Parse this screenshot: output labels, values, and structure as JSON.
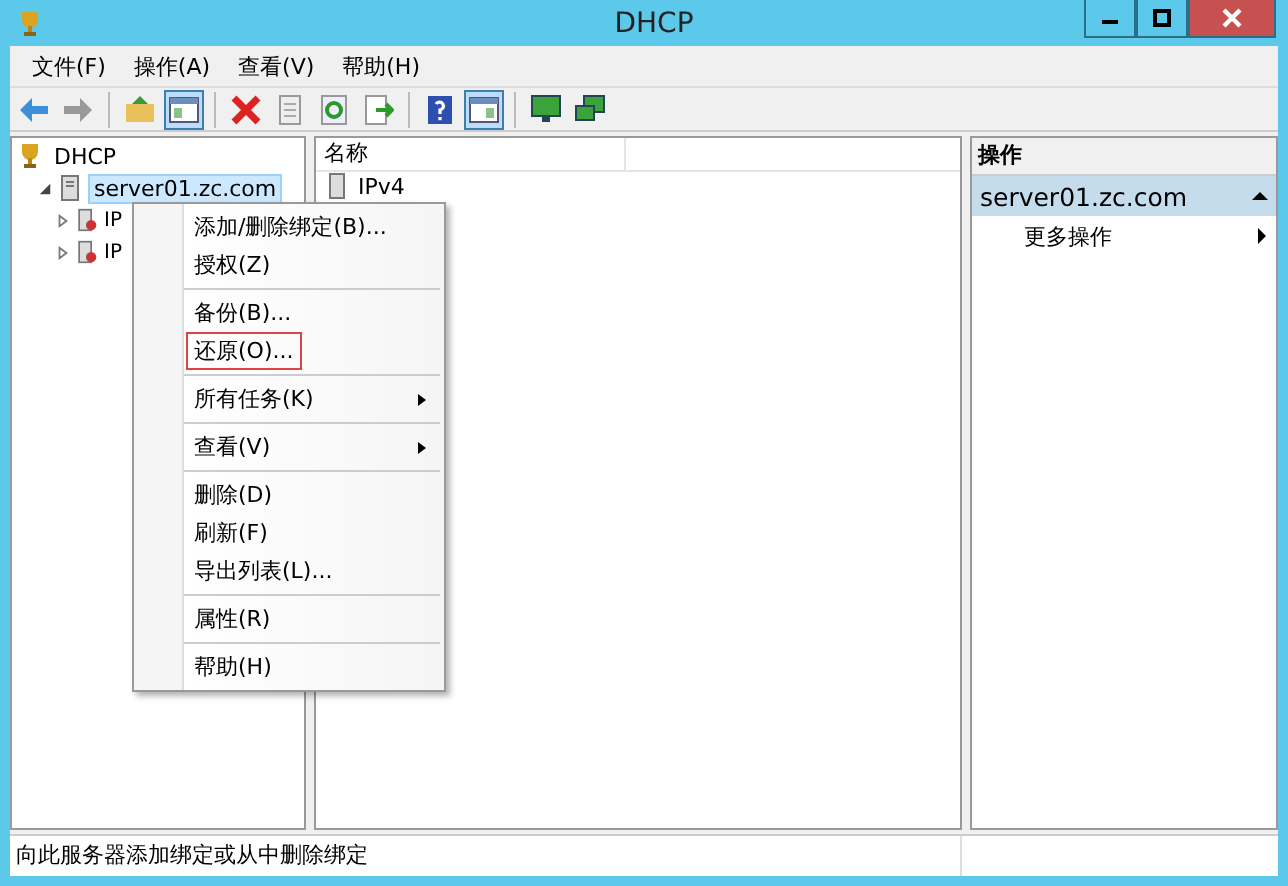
{
  "window": {
    "title": "DHCP"
  },
  "menu_bar": [
    "文件(F)",
    "操作(A)",
    "查看(V)",
    "帮助(H)"
  ],
  "toolbar": [
    {
      "kind": "back",
      "pressed": false
    },
    {
      "kind": "forward",
      "pressed": false
    },
    {
      "kind": "separator"
    },
    {
      "kind": "up",
      "pressed": false
    },
    {
      "kind": "tree",
      "pressed": true
    },
    {
      "kind": "separator"
    },
    {
      "kind": "delete",
      "pressed": false
    },
    {
      "kind": "properties",
      "pressed": false
    },
    {
      "kind": "refresh",
      "pressed": false
    },
    {
      "kind": "export",
      "pressed": false
    },
    {
      "kind": "separator"
    },
    {
      "kind": "help",
      "pressed": false
    },
    {
      "kind": "pane",
      "pressed": true
    },
    {
      "kind": "separator"
    },
    {
      "kind": "monitor",
      "pressed": false
    },
    {
      "kind": "monitors",
      "pressed": false
    }
  ],
  "tree": [
    {
      "label": "DHCP",
      "kind": "root",
      "selected": false,
      "children": [
        {
          "label": "server01.zc.com",
          "kind": "server",
          "expanded": true,
          "selected": true,
          "children": [
            {
              "label": "IP",
              "kind": "scope",
              "expanded": false,
              "selected": false
            },
            {
              "label": "IP",
              "kind": "scope",
              "expanded": false,
              "selected": false
            }
          ]
        }
      ]
    }
  ],
  "list": {
    "columns": [
      "名称"
    ],
    "rows": [
      "IPv4"
    ]
  },
  "actions": {
    "header": "操作",
    "section": "server01.zc.com",
    "expanded": true,
    "items": [
      {
        "label": "更多操作",
        "submenu": true
      }
    ]
  },
  "context_menu": [
    [
      {
        "label": "添加/删除绑定(B)...",
        "submenu": false,
        "highlighted": false
      },
      {
        "label": "授权(Z)",
        "submenu": false,
        "highlighted": false
      }
    ],
    [
      {
        "label": "备份(B)...",
        "submenu": false,
        "highlighted": false
      },
      {
        "label": "还原(O)...",
        "submenu": false,
        "highlighted": true
      }
    ],
    [
      {
        "label": "所有任务(K)",
        "submenu": true,
        "highlighted": false
      }
    ],
    [
      {
        "label": "查看(V)",
        "submenu": true,
        "highlighted": false
      }
    ],
    [
      {
        "label": "删除(D)",
        "submenu": false,
        "highlighted": false
      },
      {
        "label": "刷新(F)",
        "submenu": false,
        "highlighted": false
      },
      {
        "label": "导出列表(L)...",
        "submenu": false,
        "highlighted": false
      }
    ],
    [
      {
        "label": "属性(R)",
        "submenu": false,
        "highlighted": false
      }
    ],
    [
      {
        "label": "帮助(H)",
        "submenu": false,
        "highlighted": false
      }
    ]
  ],
  "status_bar": "向此服务器添加绑定或从中删除绑定"
}
